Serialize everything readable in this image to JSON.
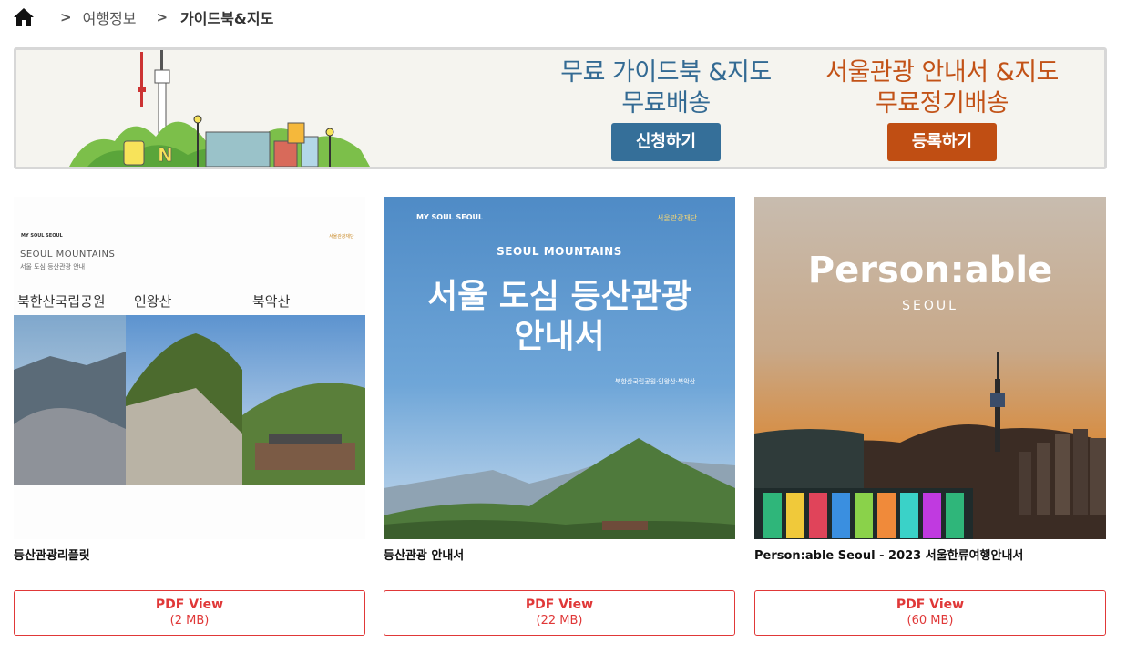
{
  "breadcrumb": {
    "separator": ">",
    "items": [
      "여행정보",
      "가이드북&지도"
    ]
  },
  "banner": {
    "free_guide_line1": "무료 가이드북 &지도",
    "free_guide_line2": "무료배송",
    "apply_button": "신청하기",
    "seoul_guide_line1": "서울관광 안내서 &지도",
    "seoul_guide_line2": "무료정기배송",
    "register_button": "등록하기",
    "colors": {
      "blue": "#336a93",
      "orange": "#c25217"
    }
  },
  "cards": [
    {
      "title": "등산관광리플릿",
      "pdf_label": "PDF View",
      "pdf_size": "(2 MB)",
      "cover": {
        "brand": "MY SOUL SEOUL",
        "logo": "서울관광재단",
        "heading": "SEOUL MOUNTAINS",
        "subheading": "서울 도심 등산관광 안내",
        "labels": [
          "북한산국립공원",
          "인왕산",
          "북악산"
        ]
      }
    },
    {
      "title": "등산관광 안내서",
      "pdf_label": "PDF View",
      "pdf_size": "(22 MB)",
      "cover": {
        "brand": "MY SOUL SEOUL",
        "logo": "서울관광재단",
        "heading": "SEOUL MOUNTAINS",
        "title_line1": "서울 도심 등산관광",
        "title_line2": "안내서",
        "caption": "북한산국립공원·인왕산·북악산"
      }
    },
    {
      "title": "Person:able Seoul - 2023 서울한류여행안내서",
      "pdf_label": "PDF View",
      "pdf_size": "(60 MB)",
      "cover": {
        "title": "Person:able",
        "subtitle": "SEOUL"
      }
    }
  ]
}
